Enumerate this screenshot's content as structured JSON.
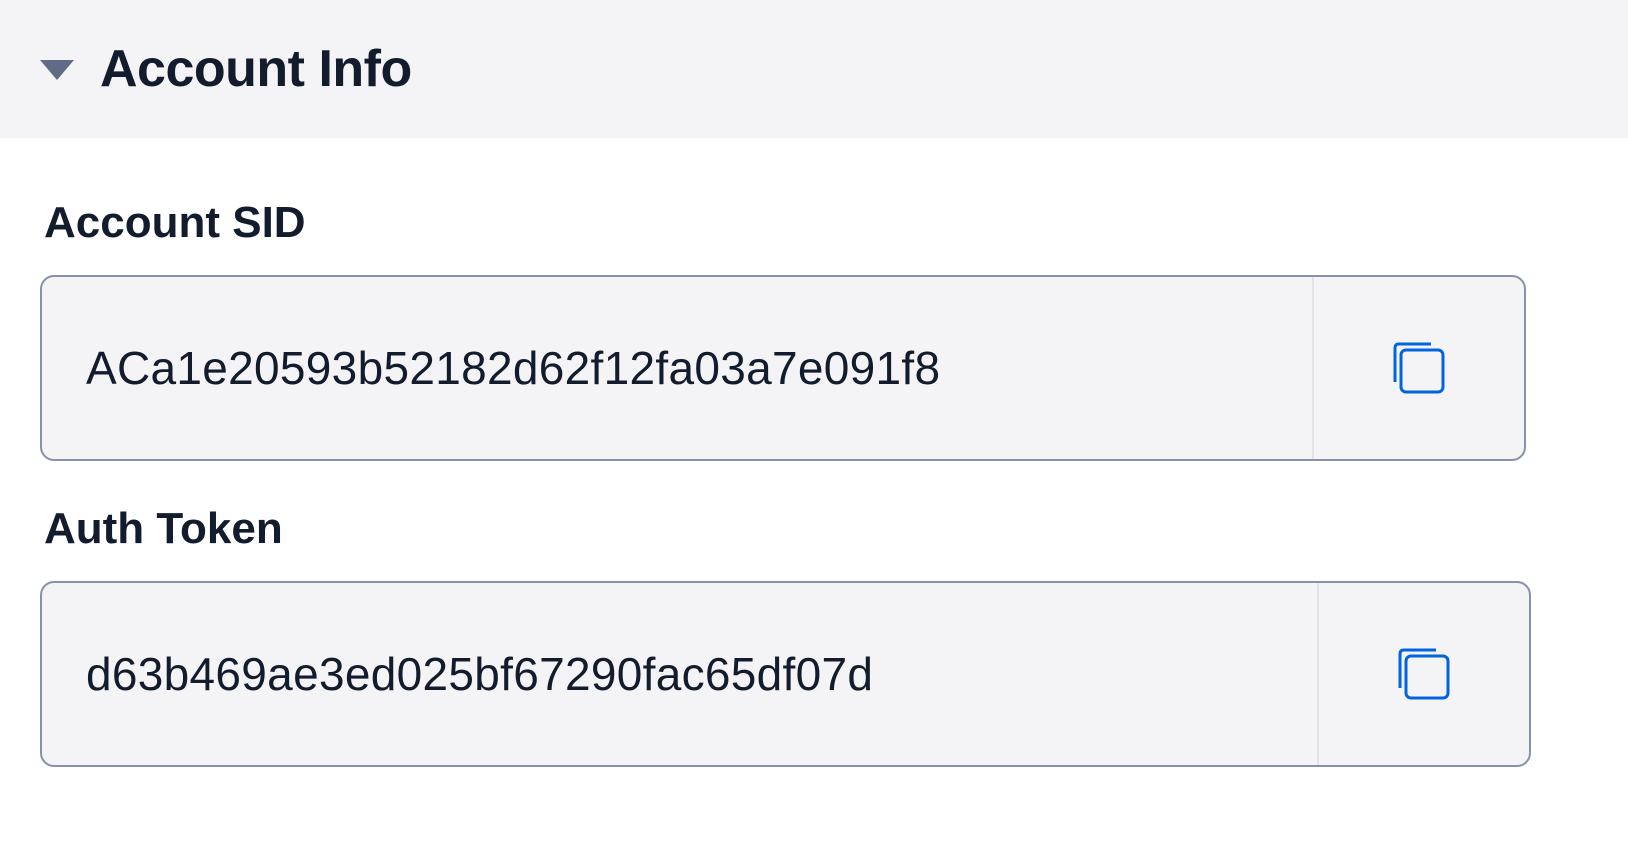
{
  "section": {
    "title": "Account Info",
    "expanded": true
  },
  "fields": [
    {
      "label": "Account SID",
      "value": "ACa1e20593b52182d62f12fa03a7e091f8",
      "copy_icon": "copy-icon"
    },
    {
      "label": "Auth Token",
      "value": "d63b469ae3ed025bf67290fac65df07d",
      "copy_icon": "copy-icon"
    }
  ],
  "colors": {
    "accent": "#0263e0",
    "text": "#121c2d",
    "header_bg": "#f4f4f6",
    "field_border": "#8891aa"
  }
}
